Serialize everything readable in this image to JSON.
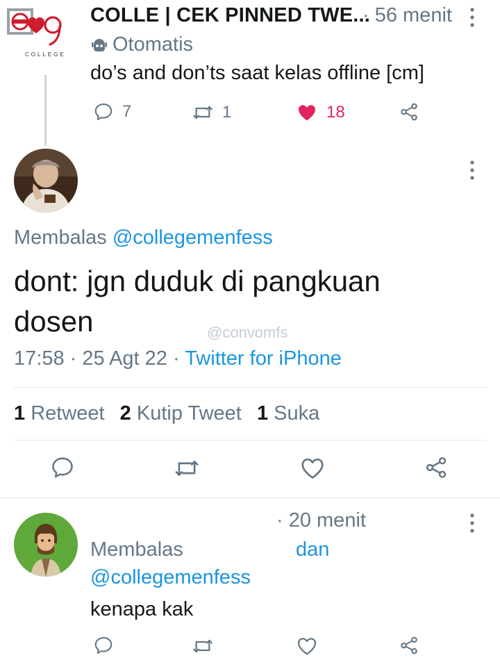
{
  "top_tweet": {
    "logo_text": "COLLEGE",
    "display_name": "COLLE | CEK PINNED TWE...",
    "time": "· 56 menit",
    "automated_label": "Otomatis",
    "text": "do’s and don’ts saat kelas offline [cm]",
    "reply_count": "7",
    "retweet_count": "1",
    "like_count": "18",
    "liked": true,
    "like_color": "#e0245e"
  },
  "main_tweet": {
    "reply_prefix": "Membalas",
    "reply_handle": "@collegemenfess",
    "text": "dont: jgn duduk di pangkuan dosen",
    "watermark": "@convomfs",
    "time": "17:58",
    "date": "25 Agt 22",
    "source": "Twitter for iPhone",
    "stats": [
      {
        "count": "1",
        "label": "Retweet"
      },
      {
        "count": "2",
        "label": "Kutip Tweet"
      },
      {
        "count": "1",
        "label": "Suka"
      }
    ]
  },
  "reply_tweet": {
    "time": "· 20 menit",
    "reply_prefix": "Membalas",
    "and_word": "dan",
    "reply_handle": "@collegemenfess",
    "text": "kenapa kak"
  },
  "colors": {
    "link": "#1b95e0",
    "muted": "#657786",
    "divider": "#e1e8ed"
  },
  "icons": [
    "more-vertical-icon",
    "robot-icon",
    "reply-icon",
    "retweet-icon",
    "heart-icon",
    "share-icon"
  ]
}
